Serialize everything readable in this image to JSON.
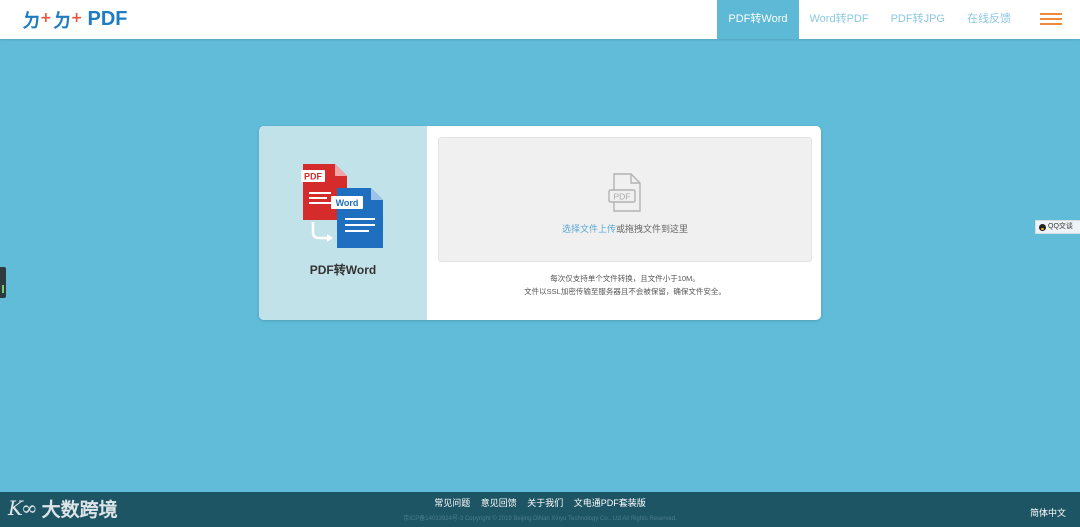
{
  "header": {
    "logo": "PDF",
    "nav": [
      "PDF转Word",
      "Word转PDF",
      "PDF转JPG",
      "在线反馈"
    ],
    "active_index": 0
  },
  "converter": {
    "title": "PDF转Word",
    "icon_badges": {
      "source": "PDF",
      "target": "Word"
    },
    "file_icon_label": "PDF",
    "upload_link": "选择文件上传",
    "drop_hint": "或拖拽文件到这里",
    "note_1": "每次仅支持单个文件转换，且文件小于10M。",
    "note_2": "文件以SSL加密传输至服务器且不会被保留，确保文件安全。"
  },
  "side": {
    "qq": "QQ交谈"
  },
  "footer": {
    "links": [
      "常见问题",
      "意见回馈",
      "关于我们",
      "文电通PDF套装版"
    ],
    "copyright": "京ICP备14033924号-3 Copyright © 2019 Beijing DiNan Xinyu Technology Co., Ltd All Rights Reserved.",
    "language": "简体中文"
  },
  "watermark": {
    "text": "大数跨境"
  },
  "colors": {
    "background": "#60bcd8",
    "active_tab": "#5db9d6",
    "pdf_red": "#d62b2b",
    "word_blue": "#1f6fc0",
    "menu_orange": "#f08a3c",
    "footer": "#1e5565"
  }
}
